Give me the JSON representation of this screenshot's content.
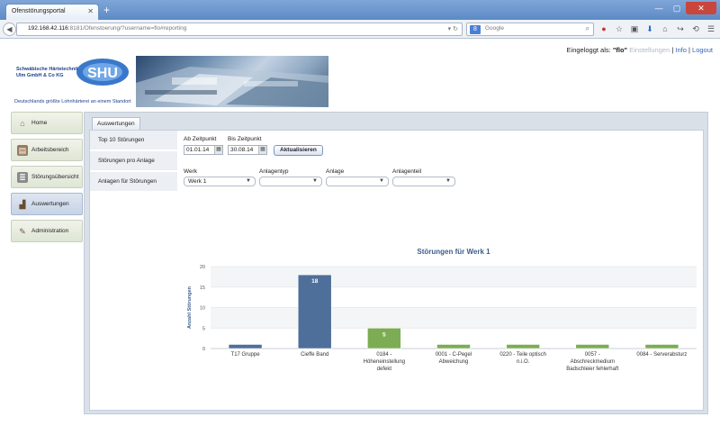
{
  "browser": {
    "tab_title": "Ofenstörungsportal",
    "url_host": "192.168.42.116",
    "url_rest": ":8181/Ofenstoerung/?username=flo#reporting",
    "search_placeholder": "Google"
  },
  "header": {
    "login_prefix": "Eingeloggt als: ",
    "user": "\"flo\"",
    "settings_link": "Einstellungen",
    "info_link": "Info",
    "logout_link": "Logout",
    "sep": "|"
  },
  "logo": {
    "company": "Schwäbische Härtetechnik Ulm GmbH & Co KG",
    "brand": "SHU",
    "tagline": "Deutschlands größte Lohnhärterei an einem Standort"
  },
  "sidenav": [
    {
      "label": "Home",
      "icon": "house-icon",
      "active": false
    },
    {
      "label": "Arbeitsbereich",
      "icon": "workspace-icon",
      "active": false
    },
    {
      "label": "Störungsübersicht",
      "icon": "overview-icon",
      "active": false
    },
    {
      "label": "Auswertungen",
      "icon": "bar-chart-icon",
      "active": true
    },
    {
      "label": "Administration",
      "icon": "tools-icon",
      "active": false
    }
  ],
  "panel": {
    "tab_label": "Auswertungen",
    "subnav": [
      "Top 10 Störungen",
      "Störungen pro Anlage",
      "Anlagen für Störungen"
    ]
  },
  "filters": {
    "from_label": "Ab Zeitpunkt",
    "from_value": "01.01.14",
    "to_label": "Bis Zeitpunkt",
    "to_value": "30.08.14",
    "update_button": "Aktualisieren",
    "werk_label": "Werk",
    "werk_value": "Werk 1",
    "anlagentyp_label": "Anlagentyp",
    "anlage_label": "Anlage",
    "anlagenteil_label": "Anlagenteil"
  },
  "chart_data": {
    "type": "bar",
    "title": "Störungen für Werk 1",
    "ylabel": "Anzahl Störungen",
    "xlabel": "",
    "ylim": [
      0,
      20
    ],
    "yticks": [
      0,
      5,
      10,
      15,
      20
    ],
    "grid": true,
    "categories": [
      "T17 Gruppe",
      "Cieffe Band",
      "0184 - Höheneinstellung defekt",
      "0001 - C-Pegel Abweichung",
      "0220 - Teile optisch n.i.O.",
      "0057 - Abschreckmedium Badschleier fehlerhaft",
      "0084 - Serverabsturz"
    ],
    "category_lines": [
      [
        "T17 Gruppe"
      ],
      [
        "Cieffe Band"
      ],
      [
        "0184 -",
        "Höheneinstellung",
        "defekt"
      ],
      [
        "0001 - C-Pegel",
        "Abweichung"
      ],
      [
        "0220 - Teile optisch",
        "n.i.O."
      ],
      [
        "0057 -",
        "Abschreckmedium",
        "Badschleier fehlerhaft"
      ],
      [
        "0084 - Serverabsturz"
      ]
    ],
    "values": [
      1,
      18,
      5,
      1,
      1,
      1,
      1
    ],
    "data_labels": [
      "",
      "18",
      "5",
      "",
      "",
      "",
      ""
    ],
    "bar_colors": [
      "#4e6f99",
      "#4e6f99",
      "#7cac54",
      "#7cac54",
      "#7cac54",
      "#7cac54",
      "#7cac54"
    ]
  }
}
